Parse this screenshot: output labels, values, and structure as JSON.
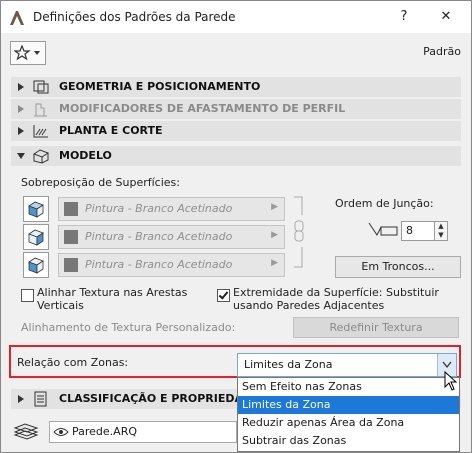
{
  "window": {
    "title": "Definições dos Padrões da Parede",
    "help_label": "?",
    "close_label": "✕",
    "favorite_label": "Padrão"
  },
  "sections": {
    "geometria": "GEOMETRIA E POSICIONAMENTO",
    "modificadores": "MODIFICADORES DE AFASTAMENTO DE PERFIL",
    "planta": "PLANTA E CORTE",
    "modelo": "MODELO",
    "classificacao": "CLASSIFICAÇÃO E PROPRIEDADES"
  },
  "modelo": {
    "surface_override_label": "Sobreposição de Superfícies:",
    "materials": [
      "Pintura - Branco Acetinado",
      "Pintura - Branco Acetinado",
      "Pintura - Branco Acetinado"
    ],
    "join_order_label": "Ordem de Junção:",
    "join_order_value": "8",
    "trunks_button": "Em Troncos...",
    "align_texture_label": "Alinhar Textura nas Arestas Verticais",
    "align_texture_checked": false,
    "surface_end_label": "Extremidade da Superfície: Substituir usando Paredes Adjacentes",
    "surface_end_checked": true,
    "custom_texture_label": "Alinhamento de Textura Personalizado:",
    "reset_texture_button": "Redefinir Textura"
  },
  "zones": {
    "label": "Relação com Zonas:",
    "selected": "Limites da Zona",
    "options": [
      "Sem Efeito nas Zonas",
      "Limites da Zona",
      "Reduzir apenas Área da Zona",
      "Subtrair das Zonas"
    ],
    "highlighted_index": 1
  },
  "footer": {
    "layer_value": "Parede.ARQ"
  },
  "colors": {
    "highlight": "#1e78d7",
    "callout": "#e0232b"
  }
}
